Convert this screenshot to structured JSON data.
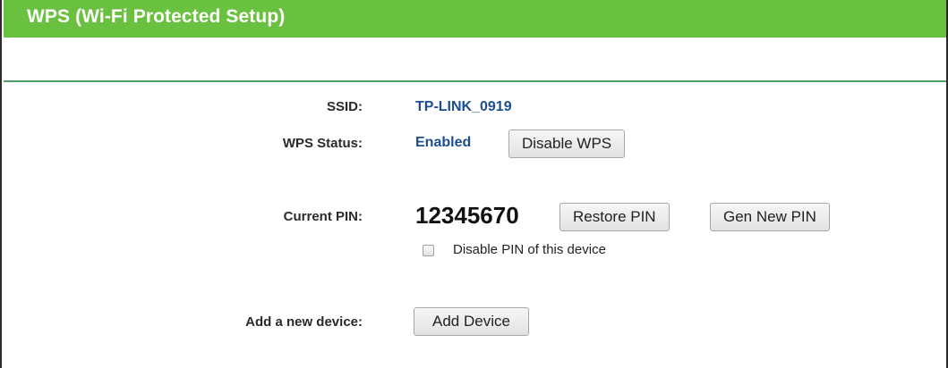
{
  "header": {
    "title": "WPS (Wi-Fi Protected Setup)"
  },
  "ssid": {
    "label": "SSID:",
    "value": "TP-LINK_0919"
  },
  "wps_status": {
    "label": "WPS Status:",
    "value": "Enabled",
    "toggle_button_label": "Disable WPS"
  },
  "current_pin": {
    "label": "Current PIN:",
    "value": "12345670",
    "restore_button_label": "Restore PIN",
    "gen_button_label": "Gen New PIN",
    "disable_checkbox_label": "Disable PIN of this device",
    "disable_checkbox_checked": false
  },
  "add_device": {
    "label": "Add a new device:",
    "button_label": "Add Device"
  },
  "colors": {
    "header_bg": "#6ac13f",
    "accent_blue": "#1d4e91",
    "divider": "#4c9e6a"
  }
}
